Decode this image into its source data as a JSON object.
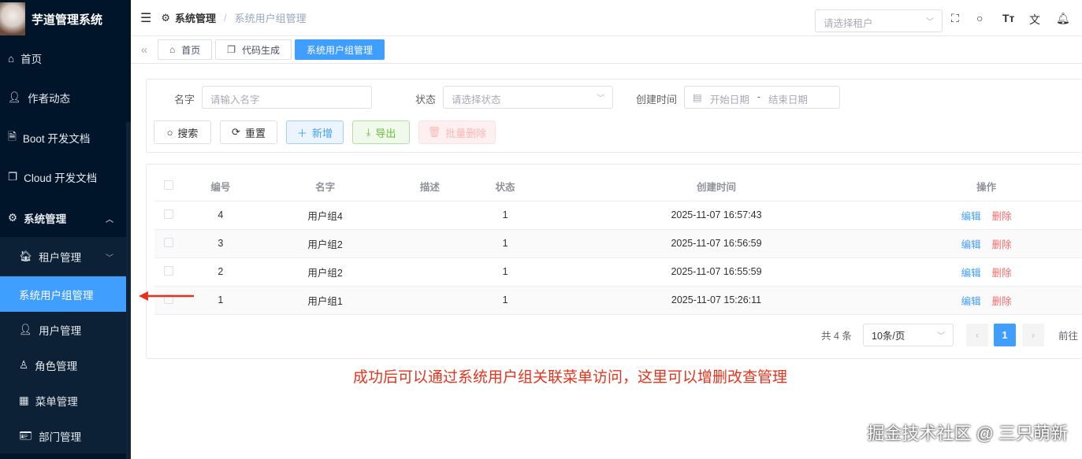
{
  "app": {
    "title": "芋道管理系统"
  },
  "sidebar": {
    "items": [
      {
        "label": "首页",
        "icon": "home-icon"
      },
      {
        "label": "作者动态",
        "icon": "user-icon"
      },
      {
        "label": "Boot 开发文档",
        "icon": "document-icon"
      },
      {
        "label": "Cloud 开发文档",
        "icon": "copy-icon"
      },
      {
        "label": "系统管理",
        "icon": "gear-icon"
      },
      {
        "label": "租户管理",
        "icon": "tenant-icon"
      },
      {
        "label": "系统用户组管理"
      },
      {
        "label": "用户管理",
        "icon": "user-icon"
      },
      {
        "label": "角色管理",
        "icon": "user-outline-icon"
      },
      {
        "label": "菜单管理",
        "icon": "grid-icon"
      },
      {
        "label": "部门管理",
        "icon": "card-icon"
      }
    ]
  },
  "header": {
    "breadcrumb": [
      "系统管理",
      "系统用户组管理"
    ],
    "tenant_placeholder": "请选择租户"
  },
  "tags": [
    "首页",
    "代码生成",
    "系统用户组管理"
  ],
  "search": {
    "name_label": "名字",
    "name_placeholder": "请输入名字",
    "status_label": "状态",
    "status_placeholder": "请选择状态",
    "time_label": "创建时间",
    "start_placeholder": "开始日期",
    "sep": "-",
    "end_placeholder": "结束日期",
    "buttons": {
      "search": "搜索",
      "reset": "重置",
      "add": "新增",
      "export": "导出",
      "batch_delete": "批量删除"
    }
  },
  "table": {
    "columns": [
      "编号",
      "名字",
      "描述",
      "状态",
      "创建时间",
      "操作"
    ],
    "rows": [
      {
        "id": "4",
        "name": "用户组4",
        "desc": "",
        "status": "1",
        "created": "2025-11-07 16:57:43"
      },
      {
        "id": "3",
        "name": "用户组2",
        "desc": "",
        "status": "1",
        "created": "2025-11-07 16:56:59"
      },
      {
        "id": "2",
        "name": "用户组2",
        "desc": "",
        "status": "1",
        "created": "2025-11-07 16:55:59"
      },
      {
        "id": "1",
        "name": "用户组1",
        "desc": "",
        "status": "1",
        "created": "2025-11-07 15:26:11"
      }
    ],
    "edit": "编辑",
    "delete": "删除"
  },
  "pagination": {
    "total": "共 4 条",
    "page_size": "10条/页",
    "current": "1",
    "goto": "前往"
  },
  "annotation": "成功后可以通过系统用户组关联菜单访问，这里可以增删改查管理",
  "watermark": "掘金技术社区 @ 三只萌新"
}
